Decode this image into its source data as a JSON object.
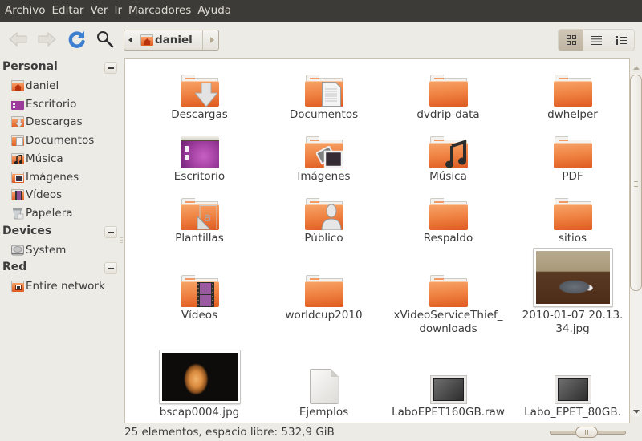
{
  "menubar": {
    "items": [
      "Archivo",
      "Editar",
      "Ver",
      "Ir",
      "Marcadores",
      "Ayuda"
    ]
  },
  "toolbar": {
    "back_icon": "back-arrow-icon",
    "forward_icon": "forward-arrow-icon",
    "reload_icon": "reload-icon",
    "search_icon": "search-icon",
    "pathbar": {
      "current": "daniel",
      "icon": "home-folder-icon"
    },
    "view_modes": [
      {
        "name": "icon-view",
        "icon": "grid-icon",
        "active": true
      },
      {
        "name": "compact-view",
        "icon": "lines-icon",
        "active": false
      },
      {
        "name": "list-view",
        "icon": "list-icon",
        "active": false
      }
    ]
  },
  "sidebar": {
    "sections": [
      {
        "title": "Personal",
        "items": [
          {
            "label": "daniel",
            "icon": "home-folder-icon"
          },
          {
            "label": "Escritorio",
            "icon": "desktop-icon"
          },
          {
            "label": "Descargas",
            "icon": "downloads-folder-icon"
          },
          {
            "label": "Documentos",
            "icon": "documents-folder-icon"
          },
          {
            "label": "Música",
            "icon": "music-folder-icon"
          },
          {
            "label": "Imágenes",
            "icon": "pictures-folder-icon"
          },
          {
            "label": "Vídeos",
            "icon": "videos-folder-icon"
          },
          {
            "label": "Papelera",
            "icon": "trash-icon"
          }
        ]
      },
      {
        "title": "Devices",
        "items": [
          {
            "label": "System",
            "icon": "harddisk-icon"
          }
        ]
      },
      {
        "title": "Red",
        "items": [
          {
            "label": "Entire network",
            "icon": "network-folder-icon"
          }
        ]
      }
    ]
  },
  "files": [
    {
      "name": "Descargas",
      "type": "folder",
      "emblem": "download"
    },
    {
      "name": "Documentos",
      "type": "folder",
      "emblem": "document"
    },
    {
      "name": "dvdrip-data",
      "type": "folder",
      "emblem": ""
    },
    {
      "name": "dwhelper",
      "type": "folder",
      "emblem": ""
    },
    {
      "name": "Escritorio",
      "type": "desktop",
      "emblem": ""
    },
    {
      "name": "Imágenes",
      "type": "folder",
      "emblem": "picture"
    },
    {
      "name": "Música",
      "type": "folder",
      "emblem": "music"
    },
    {
      "name": "PDF",
      "type": "folder",
      "emblem": ""
    },
    {
      "name": "Plantillas",
      "type": "folder",
      "emblem": "template"
    },
    {
      "name": "Público",
      "type": "folder",
      "emblem": "user"
    },
    {
      "name": "Respaldo",
      "type": "folder",
      "emblem": ""
    },
    {
      "name": "sitios",
      "type": "folder",
      "emblem": ""
    },
    {
      "name": "Vídeos",
      "type": "folder",
      "emblem": "film"
    },
    {
      "name": "worldcup2010",
      "type": "folder",
      "emblem": ""
    },
    {
      "name": "xVideoServiceThief_ downloads",
      "type": "folder",
      "emblem": ""
    },
    {
      "name": "2010-01-07 20.13. 34.jpg",
      "type": "image-dog",
      "emblem": ""
    },
    {
      "name": "bscap0004.jpg",
      "type": "image-scan",
      "emblem": ""
    },
    {
      "name": "Ejemplos",
      "type": "blank-file",
      "emblem": ""
    },
    {
      "name": "LaboEPET160GB.raw",
      "type": "disk-image",
      "emblem": ""
    },
    {
      "name": "Labo_EPET_80GB.",
      "type": "disk-image",
      "emblem": ""
    }
  ],
  "statusbar": {
    "text": "25 elementos, espacio libre: 532,9 GiB",
    "zoom_level": 0.4
  },
  "scrollbar": {
    "position": 0.0,
    "visible_fraction": 0.63
  },
  "colors": {
    "menubar_bg": "#3c3b37",
    "folder_orange": "#f08545",
    "window_bg": "#edebe6"
  }
}
